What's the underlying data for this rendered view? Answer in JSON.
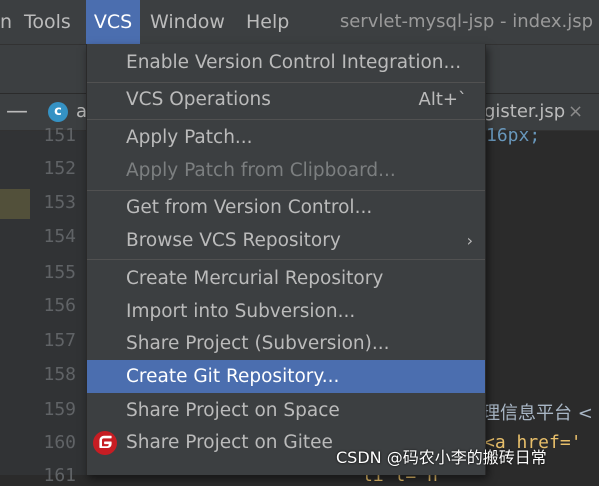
{
  "menubar": {
    "items": [
      {
        "label": "n",
        "name": "menu-partial"
      },
      {
        "label": "Tools",
        "name": "menu-tools"
      },
      {
        "label": "VCS",
        "name": "menu-vcs"
      },
      {
        "label": "Window",
        "name": "menu-window"
      },
      {
        "label": "Help",
        "name": "menu-help"
      }
    ],
    "window_title": "servlet-mysql-jsp - index.jsp"
  },
  "tabs": {
    "left_tab_icon_letter": "c",
    "left_tab_label": "a",
    "right_tab_label": "gister.jsp",
    "close": "×"
  },
  "editor": {
    "line_numbers": [
      "151",
      "152",
      "153",
      "154",
      "155",
      "156",
      "157",
      "158",
      "159",
      "160",
      "161"
    ],
    "code_fragments": {
      "line151": "16px;",
      "line159": "理信息平台 <",
      "line160": "<a href='",
      "line161": "li      l=\"h \""
    }
  },
  "vcs_menu": {
    "items": [
      {
        "label": "Enable Version Control Integration...",
        "name": "menu-item-enable-vcs"
      },
      {
        "label": "VCS Operations",
        "shortcut": "Alt+`",
        "name": "menu-item-vcs-operations"
      },
      {
        "label": "Apply Patch...",
        "name": "menu-item-apply-patch"
      },
      {
        "label": "Apply Patch from Clipboard...",
        "name": "menu-item-apply-patch-clipboard",
        "disabled": true
      },
      {
        "label": "Get from Version Control...",
        "name": "menu-item-get-from-vcs"
      },
      {
        "label": "Browse VCS Repository",
        "name": "menu-item-browse-vcs-repo",
        "submenu": "›"
      },
      {
        "label": "Create Mercurial Repository",
        "name": "menu-item-create-mercurial"
      },
      {
        "label": "Import into Subversion...",
        "name": "menu-item-import-subversion"
      },
      {
        "label": "Share Project (Subversion)...",
        "name": "menu-item-share-subversion"
      },
      {
        "label": "Create Git Repository...",
        "name": "menu-item-create-git-repo",
        "selected": true
      },
      {
        "label": "Share Project on Space",
        "name": "menu-item-share-space"
      },
      {
        "label": "Share Project on Gitee",
        "name": "menu-item-share-gitee"
      }
    ]
  },
  "watermark": "CSDN @码农小李的搬砖日常",
  "colors": {
    "menu_bg": "#3c3f41",
    "editor_bg": "#2b2b2b",
    "selection": "#4b6eaf",
    "gitee_red": "#c71d23"
  },
  "icons": {
    "tab_file": "java-class-icon",
    "gitee": "gitee-logo-icon",
    "submenu": "chevron-right-icon"
  }
}
